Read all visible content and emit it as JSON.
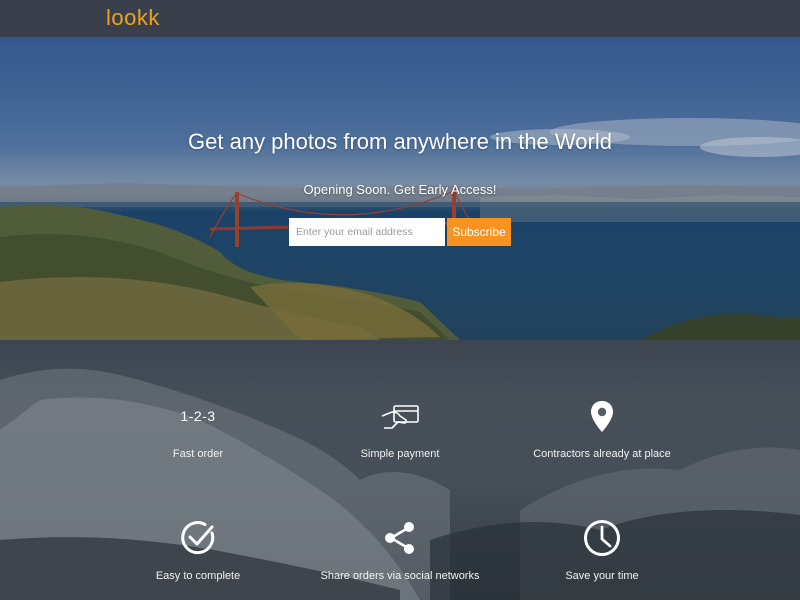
{
  "header": {
    "logo": "lookk",
    "logo_color": "#f0a01e"
  },
  "hero": {
    "title": "Get any photos from anywhere in the World",
    "subtitle": "Opening Soon. Get Early Access!",
    "email_placeholder": "Enter your email address",
    "subscribe_label": "Subscribe",
    "accent": "#f7931e"
  },
  "features": [
    {
      "icon": "steps-icon",
      "icon_text": "1-2-3",
      "label": "Fast order"
    },
    {
      "icon": "card-payment-icon",
      "label": "Simple payment"
    },
    {
      "icon": "location-pin-icon",
      "label": "Contractors already at place"
    },
    {
      "icon": "check-circle-icon",
      "label": "Easy to complete"
    },
    {
      "icon": "share-icon",
      "label": "Share orders via social networks"
    },
    {
      "icon": "clock-icon",
      "label": "Save your time"
    }
  ]
}
